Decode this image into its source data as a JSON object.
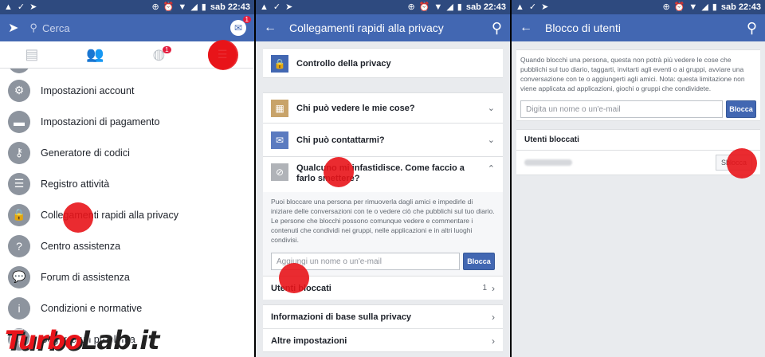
{
  "status": {
    "time": "sab 22:43"
  },
  "panel1": {
    "search_placeholder": "Cerca",
    "messenger_badge": "1",
    "friends_tab_badge": "1",
    "menu": [
      {
        "label": "Impostazioni account",
        "icon": "account-settings-icon"
      },
      {
        "label": "Impostazioni di pagamento",
        "icon": "payment-icon"
      },
      {
        "label": "Generatore di codici",
        "icon": "key-icon"
      },
      {
        "label": "Registro attività",
        "icon": "list-icon"
      },
      {
        "label": "Collegamenti rapidi alla privacy",
        "icon": "lock-icon"
      },
      {
        "label": "Centro assistenza",
        "icon": "help-icon"
      },
      {
        "label": "Forum di assistenza",
        "icon": "chat-icon"
      },
      {
        "label": "Condizioni e normative",
        "icon": "info-icon"
      },
      {
        "label": "Segnala un problema",
        "icon": "report-icon"
      }
    ]
  },
  "panel2": {
    "title": "Collegamenti rapidi alla privacy",
    "privacy_check": "Controllo della privacy",
    "who_sees": "Chi può vedere le mie cose?",
    "who_contacts": "Chi può contattarmi?",
    "harass": "Qualcuno mi infastidisce. Come faccio a farlo smettere?",
    "harass_desc": "Puoi bloccare una persona per rimuoverla dagli amici e impedirle di iniziare delle conversazioni con te o vedere ciò che pubblichi sul tuo diario. Le persone che blocchi possono comunque vedere e commentare i contenuti che condividi nei gruppi, nelle applicazioni e in altri luoghi condivisi.",
    "input_placeholder": "Aggiungi un nome o un'e-mail",
    "block_button": "Blocca",
    "blocked_users": "Utenti bloccati",
    "blocked_count": "1",
    "basic_info": "Informazioni di base sulla privacy",
    "other_settings": "Altre impostazioni"
  },
  "panel3": {
    "title": "Blocco di utenti",
    "desc": "Quando blocchi una persona, questa non potrà più vedere le cose che pubblichi sul tuo diario, taggarti, invitarti agli eventi o ai gruppi, avviare una conversazione con te o aggiungerti agli amici. Nota: questa limitazione non viene applicata ad applicazioni, giochi o gruppi che condividete.",
    "input_placeholder": "Digita un nome o un'e-mail",
    "block_button": "Blocca",
    "blocked_users": "Utenti bloccati",
    "unblock_button": "Sblocca"
  },
  "watermark": {
    "part1": "Turbo",
    "part2": "Lab.it"
  }
}
